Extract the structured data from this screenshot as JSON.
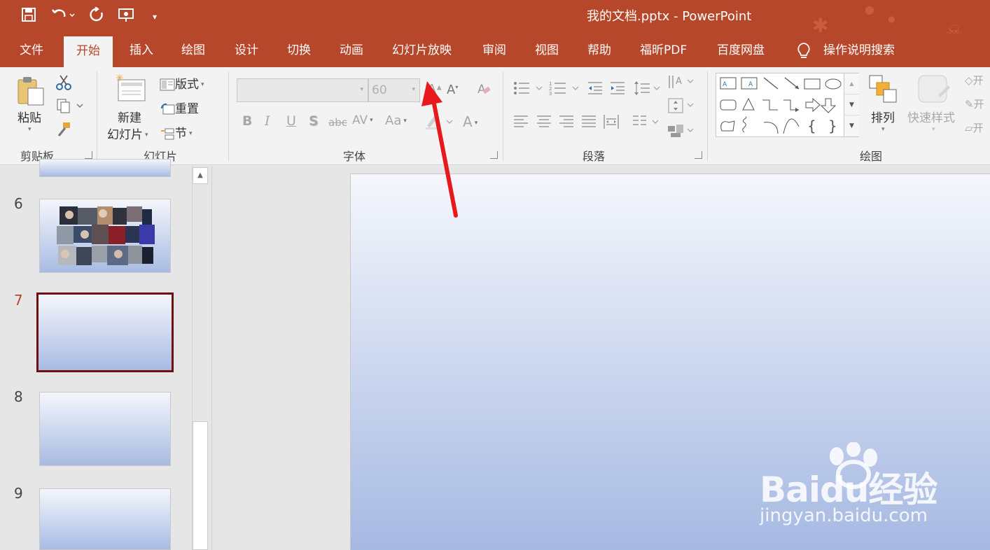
{
  "window": {
    "title": "我的文档.pptx  -  PowerPoint"
  },
  "tabs": [
    "文件",
    "开始",
    "插入",
    "绘图",
    "设计",
    "切换",
    "动画",
    "幻灯片放映",
    "审阅",
    "视图",
    "帮助",
    "福昕PDF",
    "百度网盘"
  ],
  "active_tab": "开始",
  "tell_me": "操作说明搜索",
  "ribbon": {
    "clipboard": {
      "label": "剪贴板",
      "paste": "粘贴"
    },
    "slides": {
      "label": "幻灯片",
      "new_slide_1": "新建",
      "new_slide_2": "幻灯片",
      "layout": "版式",
      "reset": "重置",
      "section": "节"
    },
    "font": {
      "label": "字体",
      "size": "60",
      "bold": "B",
      "italic": "I",
      "underline": "U",
      "shadow": "S",
      "strike": "abc",
      "spacing": "AV",
      "case": "Aa",
      "grow": "A",
      "shrink": "A",
      "color": "A"
    },
    "paragraph": {
      "label": "段落"
    },
    "drawing": {
      "label": "绘图",
      "arrange": "排列",
      "quick_styles": "快速样式",
      "side1": "开",
      "side2": "开",
      "side3": "开"
    }
  },
  "slides": [
    {
      "number": "6",
      "selected": false,
      "has_collage": true
    },
    {
      "number": "7",
      "selected": true
    },
    {
      "number": "8",
      "selected": false
    },
    {
      "number": "9",
      "selected": false
    }
  ],
  "watermark": {
    "brand": "Baidu经验",
    "url": "jingyan.baidu.com"
  },
  "colors": {
    "accent": "#b7472a",
    "annotation_arrow": "#e8191c",
    "selection_border": "#6e1010"
  }
}
